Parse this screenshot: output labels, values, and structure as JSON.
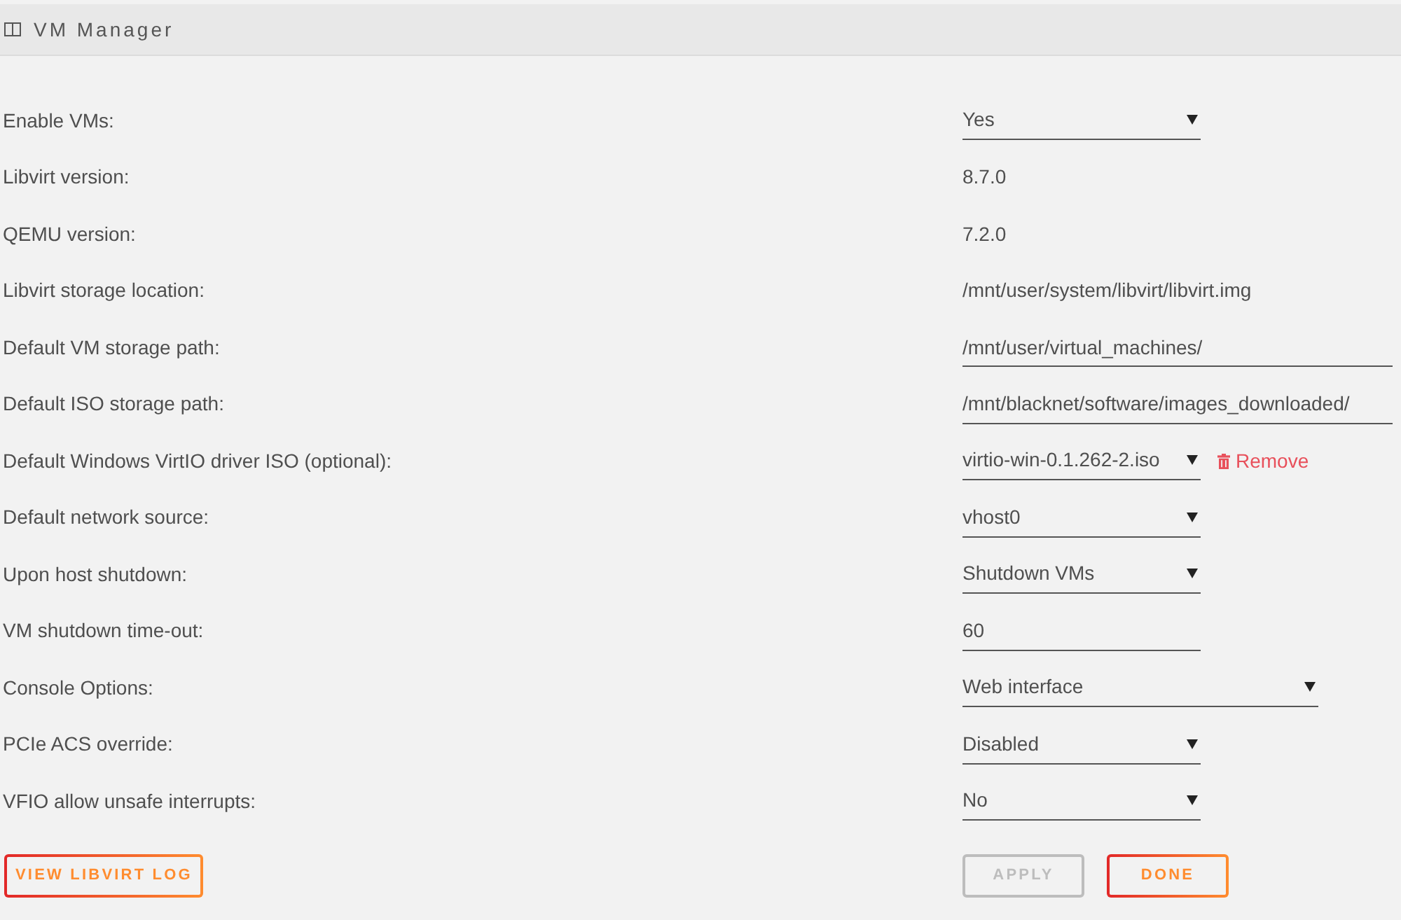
{
  "header": {
    "title": "VM Manager"
  },
  "settings": [
    {
      "label": "Enable VMs:",
      "kind": "select",
      "value": "Yes"
    },
    {
      "label": "Libvirt version:",
      "kind": "text",
      "value": "8.7.0"
    },
    {
      "label": "QEMU version:",
      "kind": "text",
      "value": "7.2.0"
    },
    {
      "label": "Libvirt storage location:",
      "kind": "text",
      "value": "/mnt/user/system/libvirt/libvirt.img"
    },
    {
      "label": "Default VM storage path:",
      "kind": "input",
      "value": "/mnt/user/virtual_machines/"
    },
    {
      "label": "Default ISO storage path:",
      "kind": "input",
      "value": "/mnt/blacknet/software/images_downloaded/"
    },
    {
      "label": "Default Windows VirtIO driver ISO (optional):",
      "kind": "select",
      "value": "virtio-win-0.1.262-2.iso",
      "action": "Remove"
    },
    {
      "label": "Default network source:",
      "kind": "select",
      "value": "vhost0"
    },
    {
      "label": "Upon host shutdown:",
      "kind": "select",
      "value": "Shutdown VMs"
    },
    {
      "label": "VM shutdown time-out:",
      "kind": "input",
      "value": "60"
    },
    {
      "label": "Console Options:",
      "kind": "select",
      "value": "Web interface"
    },
    {
      "label": "PCIe ACS override:",
      "kind": "select",
      "value": "Disabled"
    },
    {
      "label": "VFIO allow unsafe interrupts:",
      "kind": "select",
      "value": "No"
    }
  ],
  "buttons_left": [
    {
      "label": "VIEW LIBVIRT LOG",
      "disabled": false
    }
  ],
  "buttons_right": [
    {
      "label": "APPLY",
      "disabled": true
    },
    {
      "label": "DONE",
      "disabled": false
    }
  ]
}
